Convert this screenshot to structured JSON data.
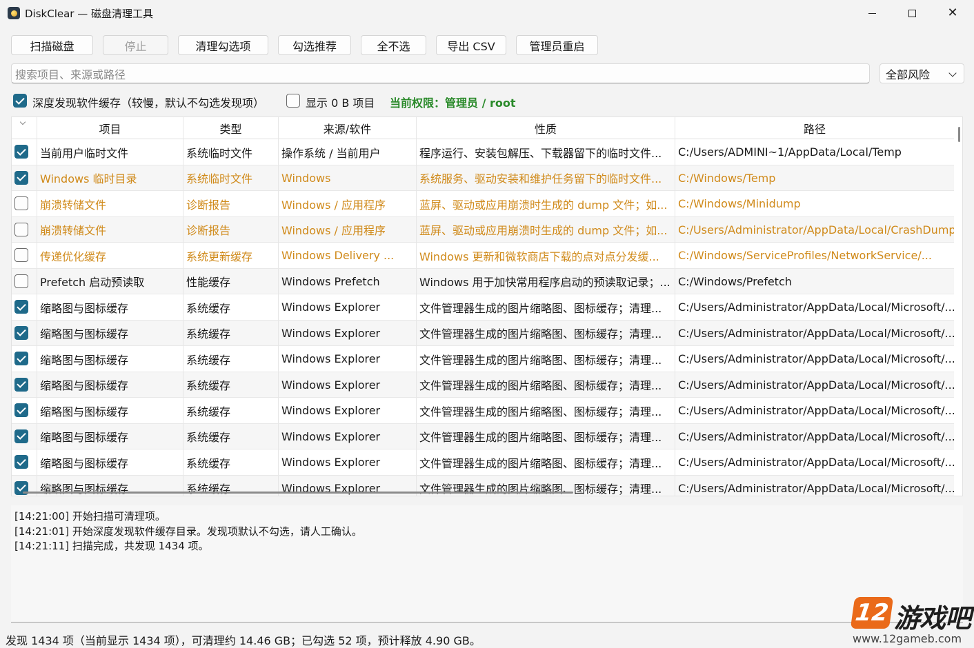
{
  "window": {
    "title": "DiskClear — 磁盘清理工具"
  },
  "toolbar": {
    "buttons": [
      {
        "label": "扫描磁盘",
        "enabled": true
      },
      {
        "label": "停止",
        "enabled": false
      },
      {
        "label": "清理勾选项",
        "enabled": true
      },
      {
        "label": "勾选推荐",
        "enabled": true
      },
      {
        "label": "全不选",
        "enabled": true
      },
      {
        "label": "导出 CSV",
        "enabled": true
      },
      {
        "label": "管理员重启",
        "enabled": true
      }
    ]
  },
  "search": {
    "placeholder": "搜索项目、来源或路径",
    "risk_filter": "全部风险"
  },
  "options": {
    "deep_scan_label": "深度发现软件缓存（较慢，默认不勾选发现项）",
    "deep_scan_checked": true,
    "show_zero_label": "显示 0 B 项目",
    "show_zero_checked": false,
    "permission_label": "当前权限：管理员 / root",
    "permission_color": "#2a8a2a"
  },
  "table": {
    "columns": [
      "项目",
      "类型",
      "来源/软件",
      "性质",
      "路径"
    ],
    "rows": [
      {
        "checked": true,
        "highlight": false,
        "item": "当前用户临时文件",
        "type": "系统临时文件",
        "source": "操作系统 / 当前用户",
        "nature": "程序运行、安装包解压、下载器留下的临时文件...",
        "path": "C:/Users/ADMINI~1/AppData/Local/Temp"
      },
      {
        "checked": true,
        "highlight": true,
        "item": "Windows 临时目录",
        "type": "系统临时文件",
        "source": "Windows",
        "nature": "系统服务、驱动安装和维护任务留下的临时文件...",
        "path": "C:/Windows/Temp"
      },
      {
        "checked": false,
        "highlight": true,
        "item": "崩溃转储文件",
        "type": "诊断报告",
        "source": "Windows / 应用程序",
        "nature": "蓝屏、驱动或应用崩溃时生成的 dump 文件；如...",
        "path": "C:/Windows/Minidump"
      },
      {
        "checked": false,
        "highlight": true,
        "item": "崩溃转储文件",
        "type": "诊断报告",
        "source": "Windows / 应用程序",
        "nature": "蓝屏、驱动或应用崩溃时生成的 dump 文件；如...",
        "path": "C:/Users/Administrator/AppData/Local/CrashDumps"
      },
      {
        "checked": false,
        "highlight": true,
        "item": "传递优化缓存",
        "type": "系统更新缓存",
        "source": "Windows Delivery ...",
        "nature": "Windows 更新和微软商店下载的点对点分发缓...",
        "path": "C:/Windows/ServiceProfiles/NetworkService/..."
      },
      {
        "checked": false,
        "highlight": false,
        "item": "Prefetch 启动预读取",
        "type": "性能缓存",
        "source": "Windows Prefetch",
        "nature": "Windows 用于加快常用程序启动的预读取记录；...",
        "path": "C:/Windows/Prefetch"
      },
      {
        "checked": true,
        "highlight": false,
        "item": "缩略图与图标缓存",
        "type": "系统缓存",
        "source": "Windows Explorer",
        "nature": "文件管理器生成的图片缩略图、图标缓存；清理...",
        "path": "C:/Users/Administrator/AppData/Local/Microsoft/..."
      },
      {
        "checked": true,
        "highlight": false,
        "item": "缩略图与图标缓存",
        "type": "系统缓存",
        "source": "Windows Explorer",
        "nature": "文件管理器生成的图片缩略图、图标缓存；清理...",
        "path": "C:/Users/Administrator/AppData/Local/Microsoft/..."
      },
      {
        "checked": true,
        "highlight": false,
        "item": "缩略图与图标缓存",
        "type": "系统缓存",
        "source": "Windows Explorer",
        "nature": "文件管理器生成的图片缩略图、图标缓存；清理...",
        "path": "C:/Users/Administrator/AppData/Local/Microsoft/..."
      },
      {
        "checked": true,
        "highlight": false,
        "item": "缩略图与图标缓存",
        "type": "系统缓存",
        "source": "Windows Explorer",
        "nature": "文件管理器生成的图片缩略图、图标缓存；清理...",
        "path": "C:/Users/Administrator/AppData/Local/Microsoft/..."
      },
      {
        "checked": true,
        "highlight": false,
        "item": "缩略图与图标缓存",
        "type": "系统缓存",
        "source": "Windows Explorer",
        "nature": "文件管理器生成的图片缩略图、图标缓存；清理...",
        "path": "C:/Users/Administrator/AppData/Local/Microsoft/..."
      },
      {
        "checked": true,
        "highlight": false,
        "item": "缩略图与图标缓存",
        "type": "系统缓存",
        "source": "Windows Explorer",
        "nature": "文件管理器生成的图片缩略图、图标缓存；清理...",
        "path": "C:/Users/Administrator/AppData/Local/Microsoft/..."
      },
      {
        "checked": true,
        "highlight": false,
        "item": "缩略图与图标缓存",
        "type": "系统缓存",
        "source": "Windows Explorer",
        "nature": "文件管理器生成的图片缩略图、图标缓存；清理...",
        "path": "C:/Users/Administrator/AppData/Local/Microsoft/..."
      },
      {
        "checked": true,
        "highlight": false,
        "item": "缩略图与图标缓存",
        "type": "系统缓存",
        "source": "Windows Explorer",
        "nature": "文件管理器生成的图片缩略图、图标缓存；清理...",
        "path": "C:/Users/Administrator/AppData/Local/Microsoft/..."
      }
    ]
  },
  "log": {
    "lines": [
      "[14:21:00] 开始扫描可清理项。",
      "[14:21:01] 开始深度发现软件缓存目录。发现项默认不勾选，请人工确认。",
      "[14:21:11] 扫描完成，共发现 1434 项。"
    ]
  },
  "status": {
    "text": "发现 1434 项（当前显示 1434 项），可清理约 14.46 GB；已勾选 52 项，预计释放 4.90 GB。"
  },
  "watermark": {
    "badge": "12",
    "name": "游戏吧",
    "url": "www.12gameb.com"
  },
  "colors": {
    "accent": "#1f6a8a",
    "highlight_text": "#d08a1a",
    "watermark_orange": "#ea6a1a"
  }
}
